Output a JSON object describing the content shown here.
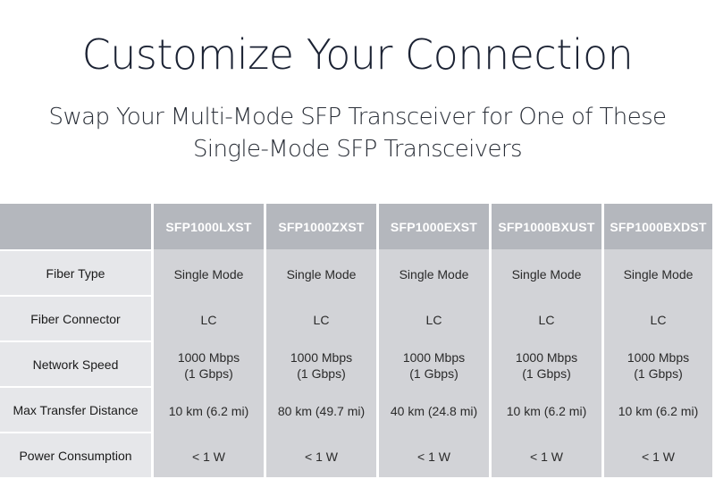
{
  "header": {
    "title": "Customize Your Connection",
    "subtitle_line1": "Swap Your Multi-Mode SFP Transceiver for One of These",
    "subtitle_line2": "Single-Mode SFP Transceivers"
  },
  "table": {
    "corner": "",
    "columns": [
      "SFP1000LXST",
      "SFP1000ZXST",
      "SFP1000EXST",
      "SFP1000BXUST",
      "SFP1000BXDST"
    ],
    "rows": [
      {
        "label": "Fiber Type",
        "values": [
          "Single Mode",
          "Single Mode",
          "Single Mode",
          "Single Mode",
          "Single Mode"
        ]
      },
      {
        "label": "Fiber Connector",
        "values": [
          "LC",
          "LC",
          "LC",
          "LC",
          "LC"
        ]
      },
      {
        "label": "Network Speed",
        "values": [
          "1000 Mbps\n(1 Gbps)",
          "1000 Mbps\n(1 Gbps)",
          "1000 Mbps\n(1 Gbps)",
          "1000 Mbps\n(1 Gbps)",
          "1000 Mbps\n(1 Gbps)"
        ]
      },
      {
        "label": "Max Transfer Distance",
        "values": [
          "10 km (6.2 mi)",
          "80 km (49.7 mi)",
          "40 km (24.8 mi)",
          "10 km (6.2 mi)",
          "10 km (6.2 mi)"
        ]
      },
      {
        "label": "Power Consumption",
        "values": [
          "< 1 W",
          "< 1 W",
          "< 1 W",
          "< 1 W",
          "< 1 W"
        ]
      }
    ]
  },
  "colors": {
    "header_bg": "#b4b7bd",
    "label_bg": "#e6e7ea",
    "value_bg": "#d2d3d7",
    "title_text": "#1b2233"
  }
}
